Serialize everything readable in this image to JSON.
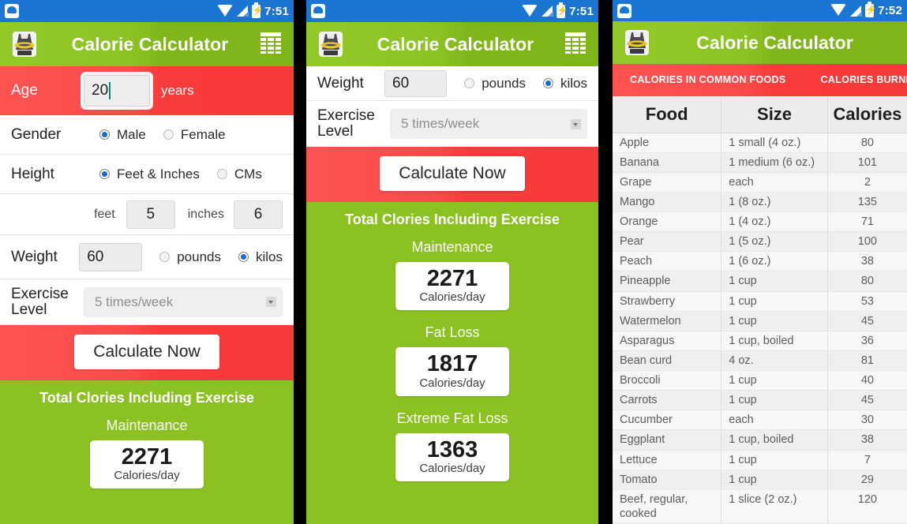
{
  "app": {
    "title": "Calorie Calculator",
    "icon": "weight-scale-icon",
    "action_icon": "grid-table-icon",
    "accent_green": "#8bc121",
    "accent_red": "#fb4a4a",
    "statusbar_blue": "#1a76d2"
  },
  "statusbar": {
    "time_left": "7:51",
    "time_mid": "7:51",
    "time_right": "7:52",
    "icons": [
      "app-notification-icon",
      "wifi-icon",
      "signal-icon",
      "battery-charging-icon"
    ]
  },
  "form": {
    "age": {
      "label": "Age",
      "value": "20",
      "suffix": "years",
      "placeholder": "Age"
    },
    "gender": {
      "label": "Gender",
      "options": [
        "Male",
        "Female"
      ],
      "selected": "Male"
    },
    "height": {
      "label": "Height",
      "unit_options": [
        "Feet & Inches",
        "CMs"
      ],
      "unit_selected": "Feet & Inches",
      "feet_label": "feet",
      "feet_value": "5",
      "inches_label": "inches",
      "inches_value": "6"
    },
    "weight": {
      "label": "Weight",
      "value": "60",
      "unit_options": [
        "pounds",
        "kilos"
      ],
      "unit_selected": "kilos"
    },
    "exercise": {
      "label": "Exercise Level",
      "label_line1": "Exercise",
      "label_line2": "Level",
      "value": "5 times/week"
    },
    "calculate_button": "Calculate Now"
  },
  "results": {
    "title": "Total Clories Including Exercise",
    "unit": "Calories/day",
    "items": [
      {
        "label": "Maintenance",
        "value": "2271"
      },
      {
        "label": "Fat Loss",
        "value": "1817"
      },
      {
        "label": "Extreme Fat Loss",
        "value": "1363"
      }
    ]
  },
  "foods_screen": {
    "tabs": [
      {
        "label": "CALORIES IN COMMON FOODS",
        "active": true
      },
      {
        "label": "CALORIES BURNING RATE (",
        "active": false
      }
    ],
    "table": {
      "columns": [
        "Food",
        "Size",
        "Calories"
      ],
      "rows": [
        [
          "Apple",
          "1 small (4 oz.)",
          "80"
        ],
        [
          "Banana",
          "1 medium (6 oz.)",
          "101"
        ],
        [
          "Grape",
          "each",
          "2"
        ],
        [
          "Mango",
          "1 (8 oz.)",
          "135"
        ],
        [
          "Orange",
          "1 (4 oz.)",
          "71"
        ],
        [
          "Pear",
          "1 (5 oz.)",
          "100"
        ],
        [
          "Peach",
          "1 (6 oz.)",
          "38"
        ],
        [
          "Pineapple",
          "1 cup",
          "80"
        ],
        [
          "Strawberry",
          "1 cup",
          "53"
        ],
        [
          "Watermelon",
          "1 cup",
          "45"
        ],
        [
          "Asparagus",
          "1 cup, boiled",
          "36"
        ],
        [
          "Bean curd",
          "4 oz.",
          "81"
        ],
        [
          "Broccoli",
          "1 cup",
          "40"
        ],
        [
          "Carrots",
          "1 cup",
          "45"
        ],
        [
          "Cucumber",
          "each",
          "30"
        ],
        [
          "Eggplant",
          "1 cup, boiled",
          "38"
        ],
        [
          "Lettuce",
          "1 cup",
          "7"
        ],
        [
          "Tomato",
          "1 cup",
          "29"
        ],
        [
          "Beef, regular, cooked",
          "1 slice (2 oz.)",
          "120"
        ]
      ]
    }
  }
}
